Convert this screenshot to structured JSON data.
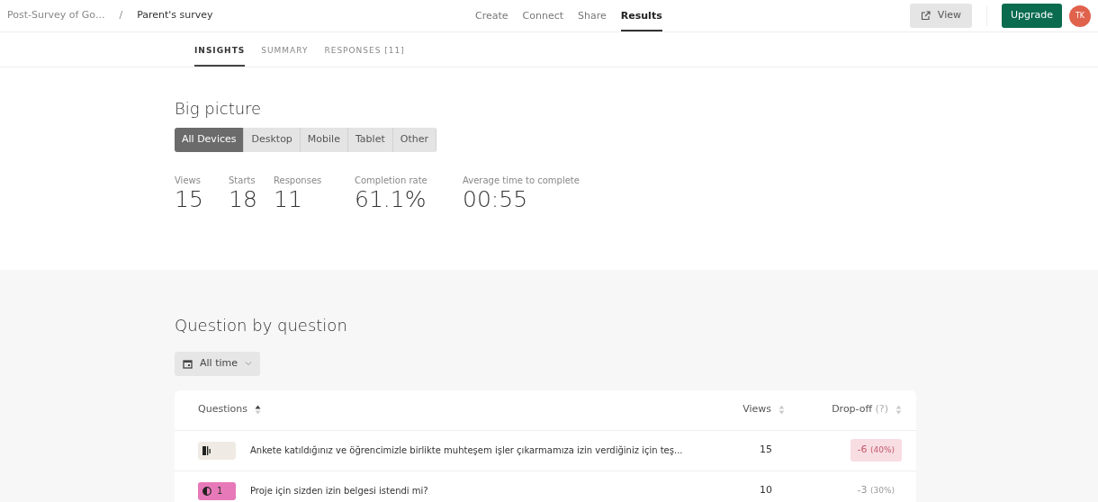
{
  "breadcrumb": [
    {
      "label": "Post-Survey of Go..."
    },
    {
      "label": "Parent's survey"
    }
  ],
  "breadcrumb_separator": "/",
  "nav": [
    {
      "label": "Create",
      "selected": false
    },
    {
      "label": "Connect",
      "selected": false
    },
    {
      "label": "Share",
      "selected": false
    },
    {
      "label": "Results",
      "selected": true
    }
  ],
  "view_button": "View",
  "upgrade_button": "Upgrade",
  "avatar": "TK",
  "subtabs": [
    {
      "label": "INSIGHTS",
      "selected": true
    },
    {
      "label": "SUMMARY",
      "selected": false
    },
    {
      "label": "RESPONSES [11]",
      "selected": false
    }
  ],
  "big_picture": {
    "title": "Big picture",
    "devices": [
      {
        "label": "All Devices",
        "selected": true
      },
      {
        "label": "Desktop",
        "selected": false
      },
      {
        "label": "Mobile",
        "selected": false
      },
      {
        "label": "Tablet",
        "selected": false
      },
      {
        "label": "Other",
        "selected": false
      }
    ],
    "stats": [
      {
        "label": "Views",
        "value": "15"
      },
      {
        "label": "Starts",
        "value": "18"
      },
      {
        "label": "Responses",
        "value": "11"
      },
      {
        "label": "Completion rate",
        "value": "61.1%"
      },
      {
        "label": "Average time to complete",
        "value": "00:55"
      }
    ]
  },
  "question_by_question": {
    "title": "Question by question",
    "date_filter": "All time",
    "columns": [
      {
        "label": "Questions"
      },
      {
        "label": "Views"
      },
      {
        "label": "Drop-off",
        "hint": "(?)"
      }
    ],
    "rows": [
      {
        "kind": "statement",
        "number": "",
        "question": "Ankete katıldığınız ve öğrencimizle birlikte muhteşem işler çıkarmamıza izin verdiğiniz için teş...",
        "views": "15",
        "dropoff": "-6",
        "dropoff_pct": "(40%)",
        "flagged": true
      },
      {
        "kind": "yesno",
        "number": "1",
        "question": "Proje için sizden izin belgesi istendi mi?",
        "views": "10",
        "dropoff": "-3",
        "dropoff_pct": "(30%)",
        "flagged": false
      }
    ]
  }
}
